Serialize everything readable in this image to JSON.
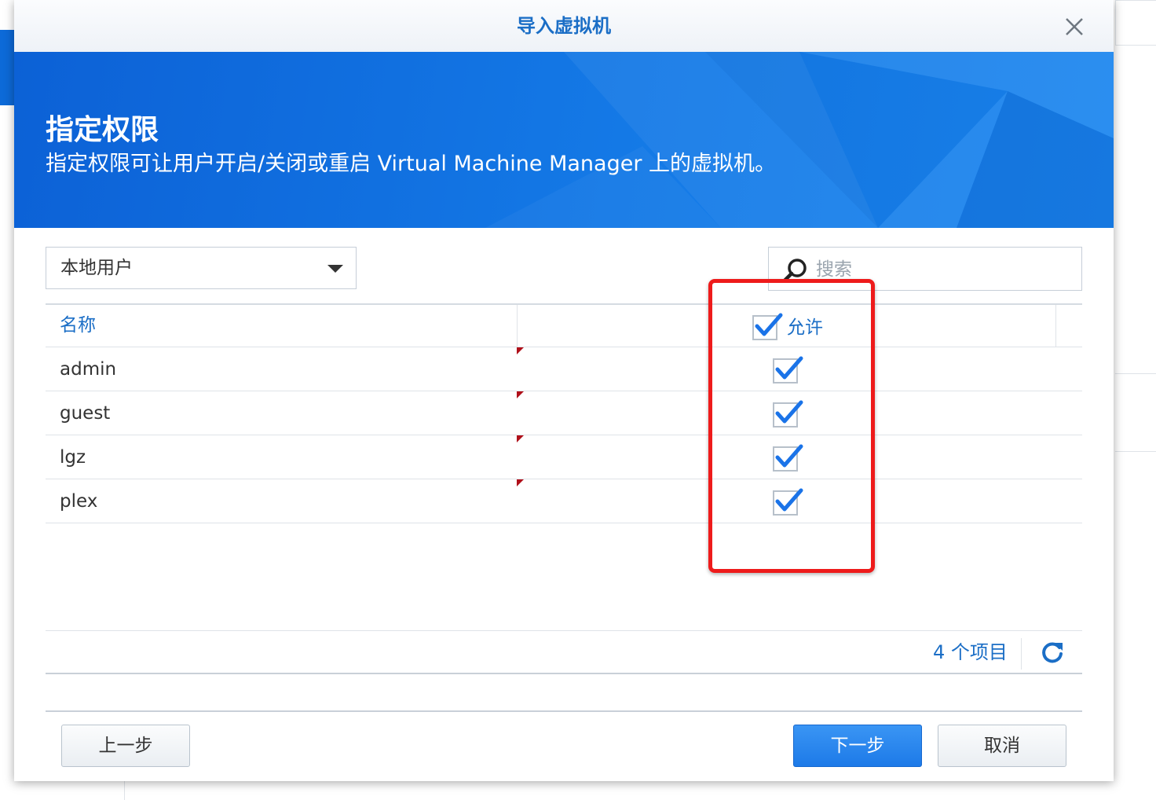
{
  "dialog": {
    "title": "导入虚拟机",
    "header_title": "指定权限",
    "header_desc": "指定权限可让用户开启/关闭或重启 Virtual Machine Manager 上的虚拟机。"
  },
  "filter": {
    "selected": "本地用户"
  },
  "search": {
    "placeholder": "搜索",
    "value": ""
  },
  "table": {
    "columns": {
      "name": "名称",
      "allow": "允许"
    },
    "header_allow_checked": true,
    "rows": [
      {
        "name": "admin",
        "allow": true
      },
      {
        "name": "guest",
        "allow": true
      },
      {
        "name": "lgz",
        "allow": true
      },
      {
        "name": "plex",
        "allow": true
      }
    ],
    "count_text": "4 个项目"
  },
  "buttons": {
    "back": "上一步",
    "next": "下一步",
    "cancel": "取消"
  },
  "icons": {
    "close": "close-icon",
    "search": "search-icon",
    "dropdown": "chevron-down-icon",
    "check": "checkmark-icon",
    "refresh": "refresh-icon"
  },
  "colors": {
    "accent": "#1b6ec6",
    "banner": "#1479e6",
    "highlight": "#ee1b1b",
    "check": "#1a73e8"
  }
}
